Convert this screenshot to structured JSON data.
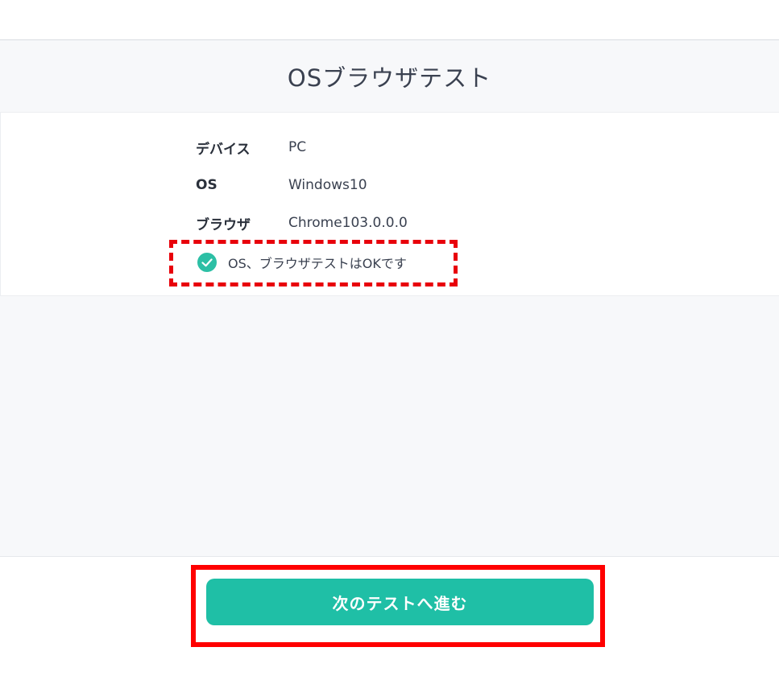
{
  "title": "OSブラウザテスト",
  "info": {
    "device": {
      "label": "デバイス",
      "value": "PC"
    },
    "os": {
      "label": "OS",
      "value": "Windows10"
    },
    "browser": {
      "label": "ブラウザ",
      "value": "Chrome103.0.0.0"
    }
  },
  "status": {
    "icon": "check-circle-icon",
    "text": "OS、ブラウザテストはOKです",
    "color": "#2cbfa5"
  },
  "footer": {
    "next_button_label": "次のテストへ進む",
    "button_color": "#1fbfa6"
  },
  "annotations": {
    "highlight_color": "#e8000b"
  }
}
